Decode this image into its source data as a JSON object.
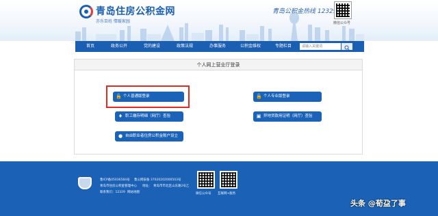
{
  "header": {
    "site_title": "青岛住房公积金网",
    "slogan": "亦乐百姓        情暖家园",
    "hotline": "青岛公积金热线 12329",
    "qr_caption": "微信公众号"
  },
  "nav": {
    "items": [
      "首页",
      "政务公开",
      "党的建设",
      "政策法规",
      "办事服务",
      "公积金维权",
      "专题栏目"
    ],
    "search_placeholder": "请输入关键词"
  },
  "panel": {
    "title": "个人网上营业厅登录",
    "buttons": {
      "standard_login": "个人普通版登录",
      "pro_login": "个人专业版登录",
      "deposit_query": "职工缴存明细（网厅）查验",
      "loan_cert_query": "异地贷款用证明（网厅）查验",
      "freelancer_account": "自由职业者住房公积金账户设立"
    }
  },
  "footer": {
    "icp": "鲁ICP备05036584号",
    "police_record": "鲁公网安备 37020202000503号",
    "organizer": "青岛市住房公积金管理中心",
    "address_label": "地址：",
    "address": "青岛市市北区山东路2号乙",
    "contact": "联系我们：12329",
    "sitemap": "网站地图",
    "qr1_caption": "微信公众号",
    "qr2_caption": "互联网+服务"
  },
  "watermark": "头条 @荀盁了事",
  "colors": {
    "brand_blue": "#1b5fb3",
    "button_blue": "#1a63b8",
    "highlight_red": "#e3281d",
    "footer_blue": "#1b62b6"
  }
}
